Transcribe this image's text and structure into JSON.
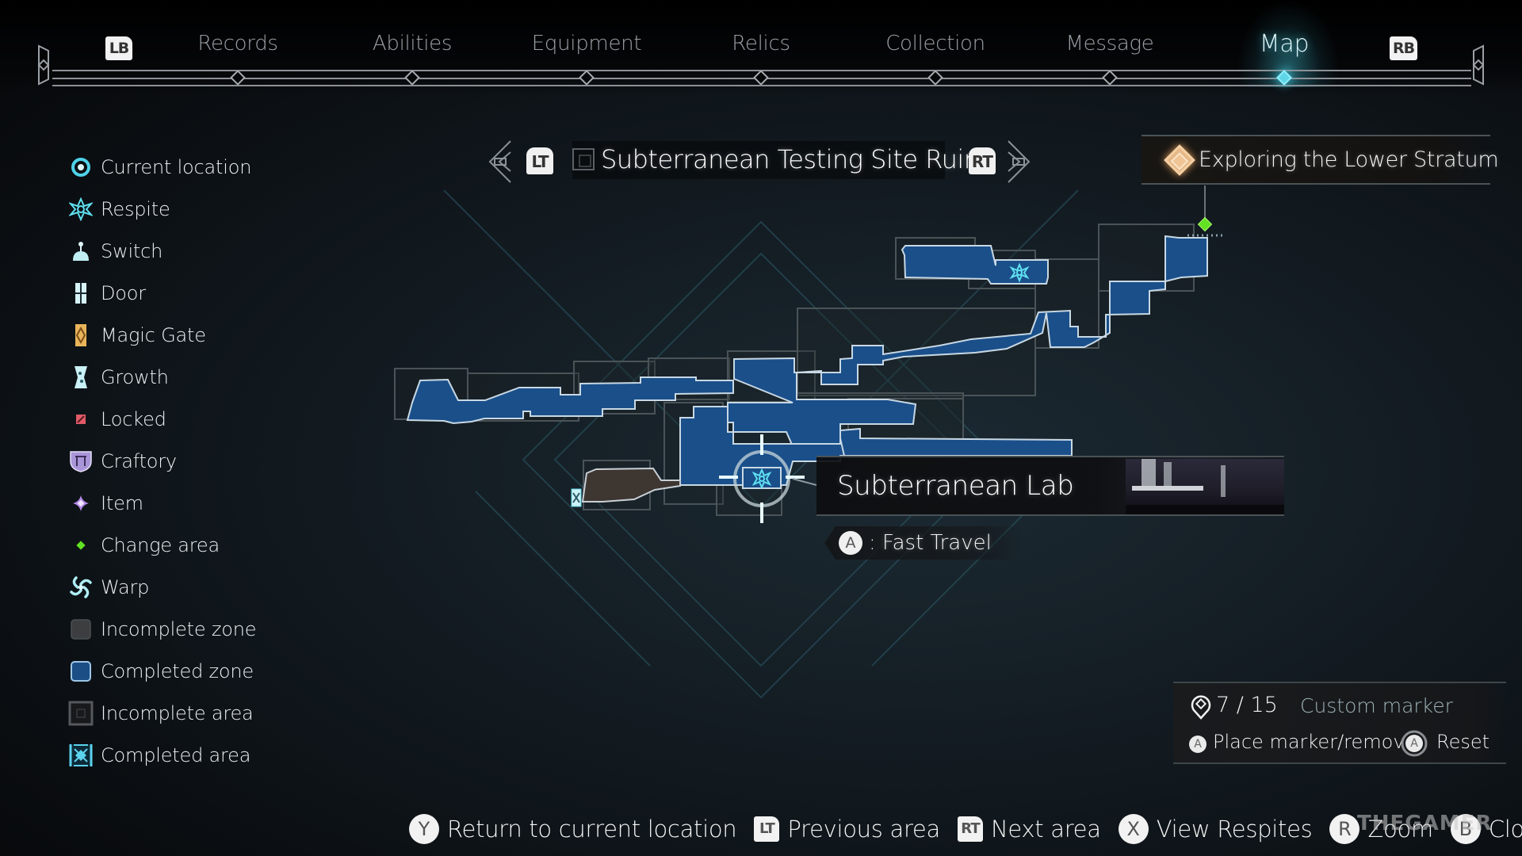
{
  "tabs": {
    "prev_button": "LB",
    "next_button": "RB",
    "items": [
      {
        "label": "Records",
        "active": false
      },
      {
        "label": "Abilities",
        "active": false
      },
      {
        "label": "Equipment",
        "active": false
      },
      {
        "label": "Relics",
        "active": false
      },
      {
        "label": "Collection",
        "active": false
      },
      {
        "label": "Message",
        "active": false
      },
      {
        "label": "Map",
        "active": true
      }
    ]
  },
  "legend": {
    "items": [
      {
        "icon": "current-location-icon",
        "label": "Current location",
        "color": "#4fd2ea"
      },
      {
        "icon": "respite-icon",
        "label": "Respite",
        "color": "#5fe0f0"
      },
      {
        "icon": "switch-icon",
        "label": "Switch",
        "color": "#bfeef4"
      },
      {
        "icon": "door-icon",
        "label": "Door",
        "color": "#d6f3f7"
      },
      {
        "icon": "magic-gate-icon",
        "label": "Magic Gate",
        "color": "#e8b45a"
      },
      {
        "icon": "growth-icon",
        "label": "Growth",
        "color": "#c9f1f6"
      },
      {
        "icon": "locked-icon",
        "label": "Locked",
        "color": "#e05a68"
      },
      {
        "icon": "craftory-icon",
        "label": "Craftory",
        "color": "#a996d8"
      },
      {
        "icon": "item-icon",
        "label": "Item",
        "color": "#b58ae8"
      },
      {
        "icon": "change-area-icon",
        "label": "Change area",
        "color": "#62e022"
      },
      {
        "icon": "warp-icon",
        "label": "Warp",
        "color": "#aeeef5"
      },
      {
        "icon": "incomplete-zone-icon",
        "label": "Incomplete zone",
        "color": "#3c3e40"
      },
      {
        "icon": "completed-zone-icon",
        "label": "Completed zone",
        "color": "#1c4e86"
      },
      {
        "icon": "incomplete-area-icon",
        "label": "Incomplete area",
        "color": "#55595d"
      },
      {
        "icon": "completed-area-icon",
        "label": "Completed area",
        "color": "#5cd3ee"
      }
    ]
  },
  "area": {
    "title": "Subterranean Testing Site Ruins",
    "prev_button": "LT",
    "next_button": "RT"
  },
  "quest": {
    "title": "Exploring the Lower Stratum"
  },
  "location": {
    "name": "Subterranean Lab",
    "action_button": "A",
    "action_label": ": Fast Travel"
  },
  "marker": {
    "count": "7 / 15",
    "label": "Custom marker",
    "place_button": "A",
    "place_label": "Place marker/remove",
    "reset_button": "A",
    "reset_label": "Reset"
  },
  "hints": [
    {
      "button": "Y",
      "label": "Return to current location",
      "shape": "circle"
    },
    {
      "button": "LT",
      "label": "Previous area",
      "shape": "square"
    },
    {
      "button": "RT",
      "label": "Next area",
      "shape": "square"
    },
    {
      "button": "X",
      "label": "View Respites",
      "shape": "circle"
    },
    {
      "button": "R",
      "label": "Zoom",
      "shape": "circle"
    },
    {
      "button": "B",
      "label": "Close",
      "shape": "circle"
    }
  ],
  "watermark": "THEGAMER",
  "colors": {
    "accent": "#5fd5e6",
    "completed_zone": "#1a4f8a",
    "zone_outline": "#c8d8e4",
    "area_border": "#4a5357",
    "change_area": "#62e022",
    "quest": "#e6b886"
  }
}
